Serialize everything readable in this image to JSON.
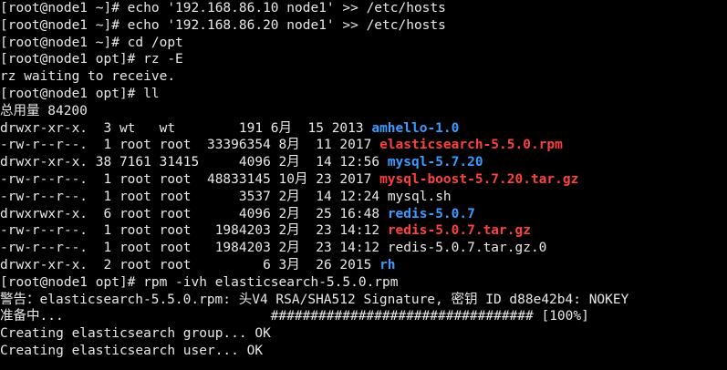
{
  "lines": [
    {
      "text": "[root@node1 ~]# echo '192.168.86.10 node1' >> /etc/hosts"
    },
    {
      "text": "[root@node1 ~]# echo '192.168.86.20 node1' >> /etc/hosts"
    },
    {
      "text": "[root@node1 ~]# cd /opt"
    },
    {
      "text": "[root@node1 opt]# rz -E"
    },
    {
      "text": "rz waiting to receive."
    },
    {
      "text": "[root@node1 opt]# ll"
    },
    {
      "text": "总用量 84200"
    },
    {
      "prefix": "drwxr-xr-x.  3 wt   wt        191 6月  15 2013 ",
      "name": "amhello-1.0",
      "kind": "dir"
    },
    {
      "prefix": "-rw-r--r--.  1 root root  33396354 8月  11 2017 ",
      "name": "elasticsearch-5.5.0.rpm",
      "kind": "archive"
    },
    {
      "prefix": "drwxr-xr-x. 38 7161 31415     4096 2月  14 12:56 ",
      "name": "mysql-5.7.20",
      "kind": "dir"
    },
    {
      "prefix": "-rw-r--r--.  1 root root  48833145 10月 23 2017 ",
      "name": "mysql-boost-5.7.20.tar.gz",
      "kind": "archive"
    },
    {
      "prefix": "-rw-r--r--.  1 root root      3537 2月  14 12:24 ",
      "name": "mysql.sh",
      "kind": "plain"
    },
    {
      "prefix": "drwxrwxr-x.  6 root root      4096 2月  25 16:48 ",
      "name": "redis-5.0.7",
      "kind": "dir"
    },
    {
      "prefix": "-rw-r--r--.  1 root root   1984203 2月  23 14:12 ",
      "name": "redis-5.0.7.tar.gz",
      "kind": "archive"
    },
    {
      "prefix": "-rw-r--r--.  1 root root   1984203 2月  23 14:12 ",
      "name": "redis-5.0.7.tar.gz.0",
      "kind": "plain"
    },
    {
      "prefix": "drwxr-xr-x.  2 root root         6 3月  26 2015 ",
      "name": "rh",
      "kind": "dir"
    },
    {
      "text": "[root@node1 opt]# rpm -ivh elasticsearch-5.5.0.rpm"
    },
    {
      "text": "警告：elasticsearch-5.5.0.rpm: 头V4 RSA/SHA512 Signature, 密钥 ID d88e42b4: NOKEY"
    },
    {
      "text": "准备中...                          ################################# [100%]"
    },
    {
      "text": "Creating elasticsearch group... OK"
    },
    {
      "text": "Creating elasticsearch user... OK"
    }
  ],
  "colors": {
    "background": "#000000",
    "text": "#e8e8e8",
    "directory": "#3b9bff",
    "archive": "#ff4040"
  }
}
